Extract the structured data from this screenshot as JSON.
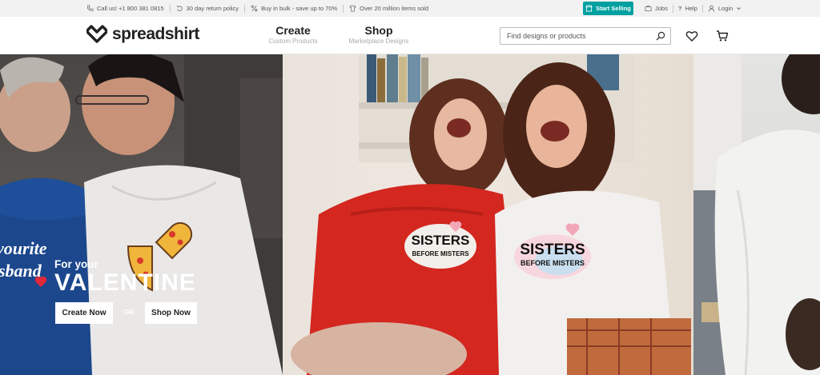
{
  "topbar": {
    "phone": "Call us! +1 800 381 0815",
    "returns": "30 day return policy",
    "bulk": "Buy in bulk - save up to 70%",
    "sold": "Over 20 million items sold",
    "start_selling": "Start Selling",
    "jobs": "Jobs",
    "help": "Help",
    "login": "Login"
  },
  "header": {
    "brand": "spreadshirt",
    "nav": [
      {
        "label": "Create",
        "sub": "Custom Products"
      },
      {
        "label": "Shop",
        "sub": "Marketplace Designs"
      }
    ],
    "search_placeholder": "Find designs or products"
  },
  "hero": {
    "tagline_small": "For your",
    "tagline_big": "VALENTINE",
    "create_now": "Create Now",
    "or": "OR",
    "shop_now": "Shop Now",
    "shirt_text_1": "SISTERS",
    "shirt_text_2": "BEFORE MISTERS",
    "hoodie_text_1": "vourite",
    "hoodie_text_2": "sband"
  },
  "colors": {
    "accent": "#00a0a0",
    "topbar_bg": "#f2f2f2"
  }
}
